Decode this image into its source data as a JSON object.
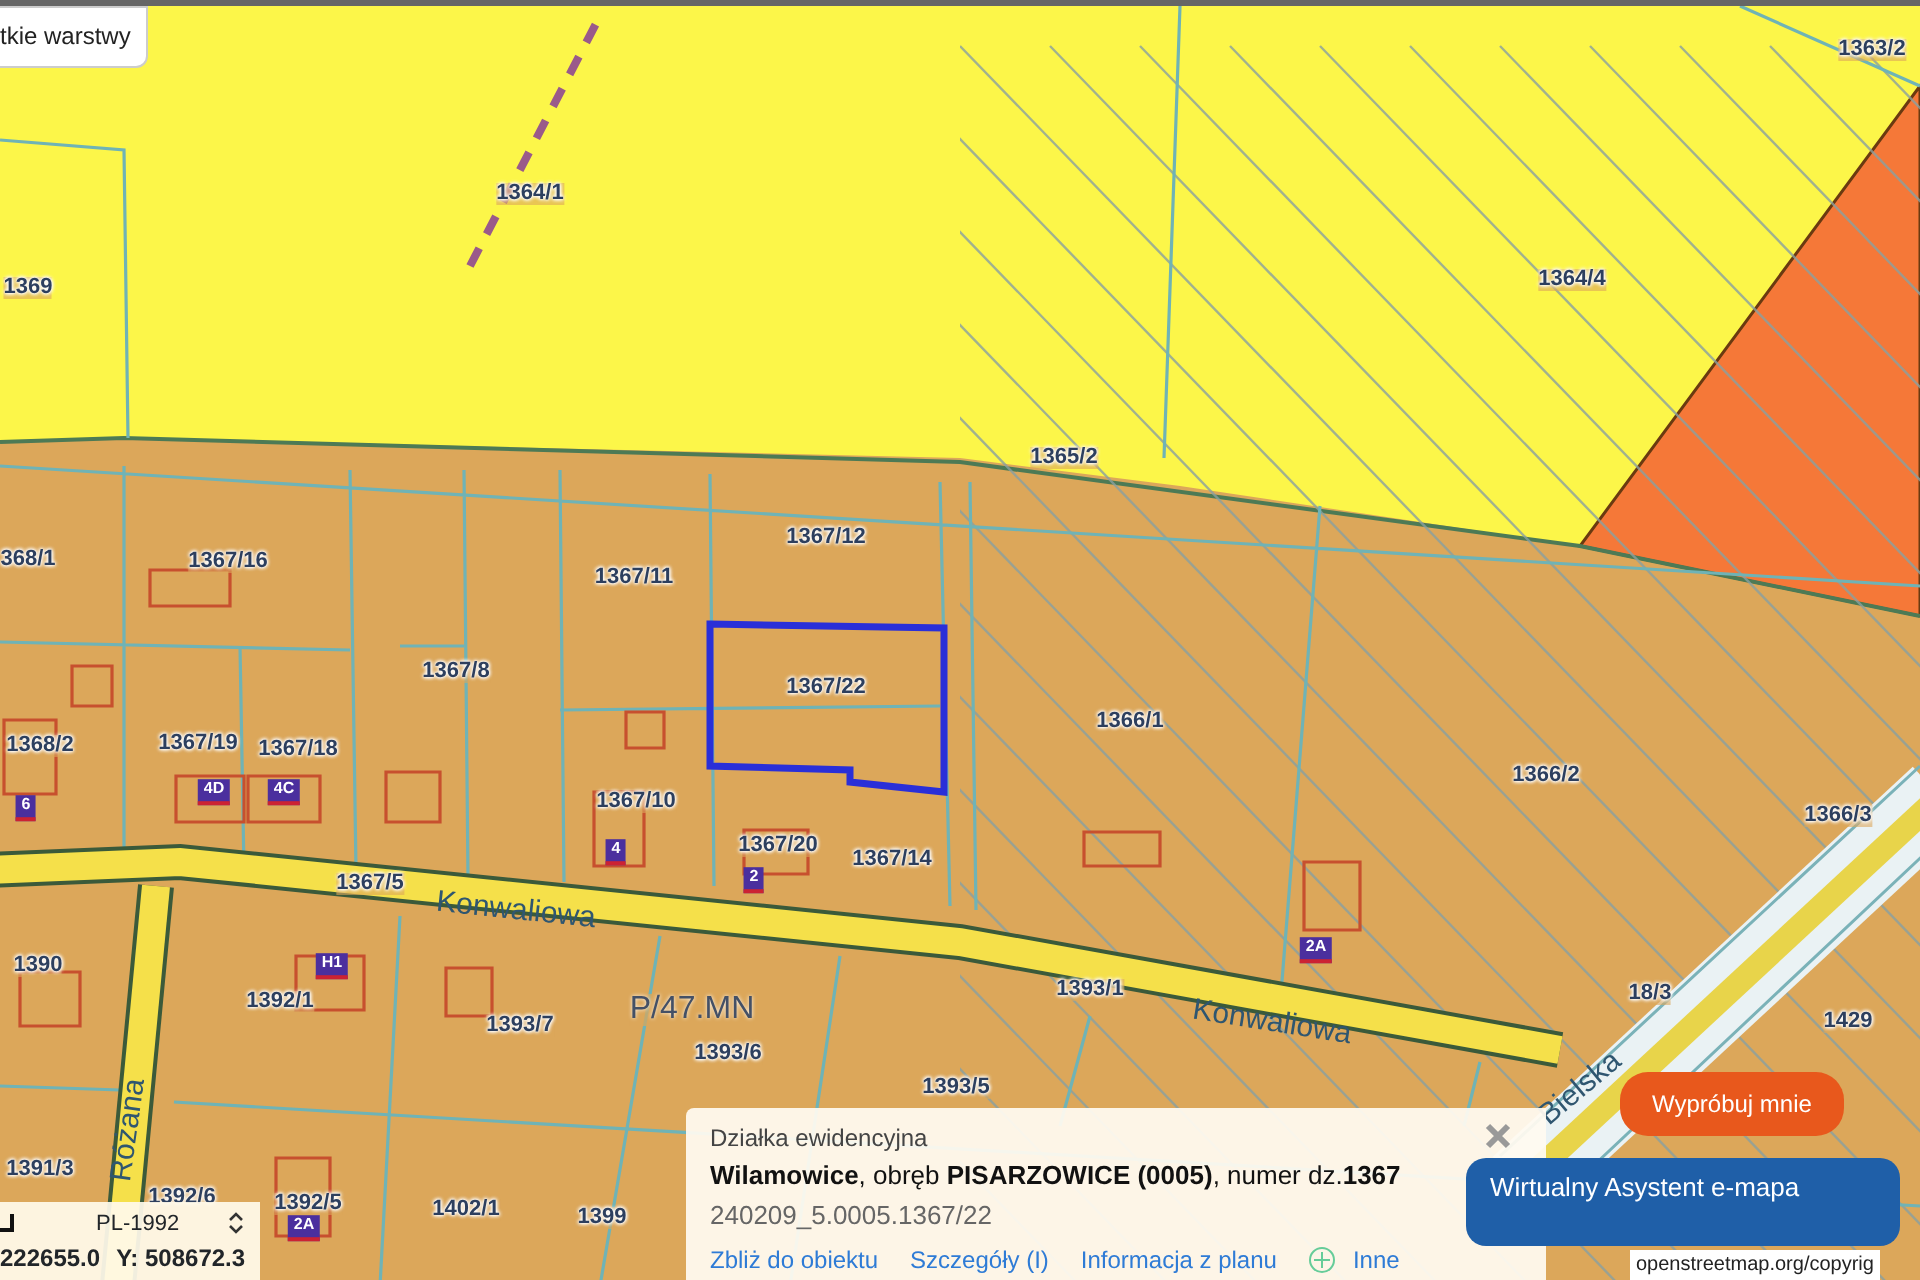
{
  "layers_button": {
    "label": "tkie warstwy"
  },
  "map": {
    "parcels": [
      {
        "label": "1364/1",
        "selected": false
      },
      {
        "label": "1369",
        "selected": false
      },
      {
        "label": "1363/2",
        "selected": false
      },
      {
        "label": "1364/4",
        "selected": false
      },
      {
        "label": "1365/2",
        "selected": false
      },
      {
        "label": "368/1",
        "selected": false
      },
      {
        "label": "1367/16",
        "selected": false
      },
      {
        "label": "1367/12",
        "selected": false
      },
      {
        "label": "1367/11",
        "selected": false
      },
      {
        "label": "1367/8",
        "selected": false
      },
      {
        "label": "1367/22",
        "selected": true
      },
      {
        "label": "1366/1",
        "selected": false
      },
      {
        "label": "1366/2",
        "selected": false
      },
      {
        "label": "1368/2",
        "selected": false
      },
      {
        "label": "1367/19",
        "selected": false
      },
      {
        "label": "1367/18",
        "selected": false
      },
      {
        "label": "1367/10",
        "selected": false
      },
      {
        "label": "1366/3",
        "selected": false
      },
      {
        "label": "1367/20",
        "selected": false
      },
      {
        "label": "1367/14",
        "selected": false
      },
      {
        "label": "1367/5",
        "selected": false
      },
      {
        "label": "1390",
        "selected": false
      },
      {
        "label": "1392/1",
        "selected": false
      },
      {
        "label": "1393/1",
        "selected": false
      },
      {
        "label": "18/3",
        "selected": false
      },
      {
        "label": "1393/7",
        "selected": false
      },
      {
        "label": "1429",
        "selected": false
      },
      {
        "label": "1393/6",
        "selected": false
      },
      {
        "label": "1393/5",
        "selected": false
      },
      {
        "label": "1391/3",
        "selected": false
      },
      {
        "label": "1392/6",
        "selected": false
      },
      {
        "label": "1392/5",
        "selected": false
      },
      {
        "label": "1402/1",
        "selected": false
      },
      {
        "label": "1399",
        "selected": false
      }
    ],
    "zones": [
      {
        "label": "P/47.MN"
      }
    ],
    "streets": [
      {
        "label": "Konwaliowa"
      },
      {
        "label": "Konwaliowa"
      },
      {
        "label": "Różana"
      },
      {
        "label": "Bielska"
      }
    ],
    "building_numbers": [
      "6",
      "4D",
      "4C",
      "4",
      "2",
      "2A",
      "H1",
      "2A"
    ]
  },
  "coordinates": {
    "system": "PL-1992",
    "x_value": "222655.0",
    "y_value": "Y: 508672.3"
  },
  "popup": {
    "title": "Działka ewidencyjna",
    "description": "**Wilamowice**, obręb **PISARZOWICE (0005)**, numer dz.**1367**",
    "identifier": "240209_5.0005.1367/22",
    "links": [
      "Zbliż do obiektu",
      "Szczegóły (I)",
      "Informacja z planu"
    ],
    "more_link": "Inne"
  },
  "assistant": {
    "prompt": "Wypróbuj mnie",
    "button": "Wirtualny Asystent e-mapa"
  },
  "attribution": "openstreetmap.org/copyrig"
}
